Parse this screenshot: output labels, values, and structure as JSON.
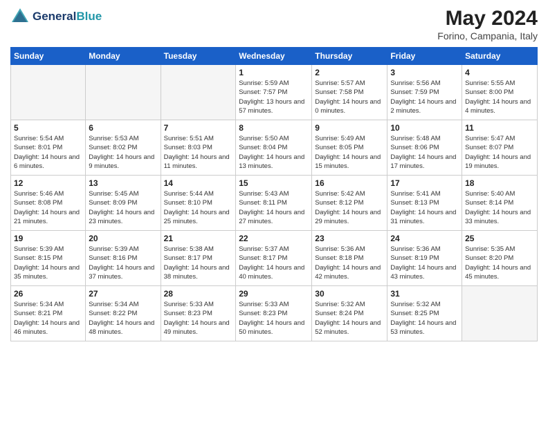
{
  "header": {
    "logo_line1": "General",
    "logo_line2": "Blue",
    "month": "May 2024",
    "location": "Forino, Campania, Italy"
  },
  "weekdays": [
    "Sunday",
    "Monday",
    "Tuesday",
    "Wednesday",
    "Thursday",
    "Friday",
    "Saturday"
  ],
  "weeks": [
    [
      {
        "day": "",
        "info": ""
      },
      {
        "day": "",
        "info": ""
      },
      {
        "day": "",
        "info": ""
      },
      {
        "day": "1",
        "info": "Sunrise: 5:59 AM\nSunset: 7:57 PM\nDaylight: 13 hours\nand 57 minutes."
      },
      {
        "day": "2",
        "info": "Sunrise: 5:57 AM\nSunset: 7:58 PM\nDaylight: 14 hours\nand 0 minutes."
      },
      {
        "day": "3",
        "info": "Sunrise: 5:56 AM\nSunset: 7:59 PM\nDaylight: 14 hours\nand 2 minutes."
      },
      {
        "day": "4",
        "info": "Sunrise: 5:55 AM\nSunset: 8:00 PM\nDaylight: 14 hours\nand 4 minutes."
      }
    ],
    [
      {
        "day": "5",
        "info": "Sunrise: 5:54 AM\nSunset: 8:01 PM\nDaylight: 14 hours\nand 6 minutes."
      },
      {
        "day": "6",
        "info": "Sunrise: 5:53 AM\nSunset: 8:02 PM\nDaylight: 14 hours\nand 9 minutes."
      },
      {
        "day": "7",
        "info": "Sunrise: 5:51 AM\nSunset: 8:03 PM\nDaylight: 14 hours\nand 11 minutes."
      },
      {
        "day": "8",
        "info": "Sunrise: 5:50 AM\nSunset: 8:04 PM\nDaylight: 14 hours\nand 13 minutes."
      },
      {
        "day": "9",
        "info": "Sunrise: 5:49 AM\nSunset: 8:05 PM\nDaylight: 14 hours\nand 15 minutes."
      },
      {
        "day": "10",
        "info": "Sunrise: 5:48 AM\nSunset: 8:06 PM\nDaylight: 14 hours\nand 17 minutes."
      },
      {
        "day": "11",
        "info": "Sunrise: 5:47 AM\nSunset: 8:07 PM\nDaylight: 14 hours\nand 19 minutes."
      }
    ],
    [
      {
        "day": "12",
        "info": "Sunrise: 5:46 AM\nSunset: 8:08 PM\nDaylight: 14 hours\nand 21 minutes."
      },
      {
        "day": "13",
        "info": "Sunrise: 5:45 AM\nSunset: 8:09 PM\nDaylight: 14 hours\nand 23 minutes."
      },
      {
        "day": "14",
        "info": "Sunrise: 5:44 AM\nSunset: 8:10 PM\nDaylight: 14 hours\nand 25 minutes."
      },
      {
        "day": "15",
        "info": "Sunrise: 5:43 AM\nSunset: 8:11 PM\nDaylight: 14 hours\nand 27 minutes."
      },
      {
        "day": "16",
        "info": "Sunrise: 5:42 AM\nSunset: 8:12 PM\nDaylight: 14 hours\nand 29 minutes."
      },
      {
        "day": "17",
        "info": "Sunrise: 5:41 AM\nSunset: 8:13 PM\nDaylight: 14 hours\nand 31 minutes."
      },
      {
        "day": "18",
        "info": "Sunrise: 5:40 AM\nSunset: 8:14 PM\nDaylight: 14 hours\nand 33 minutes."
      }
    ],
    [
      {
        "day": "19",
        "info": "Sunrise: 5:39 AM\nSunset: 8:15 PM\nDaylight: 14 hours\nand 35 minutes."
      },
      {
        "day": "20",
        "info": "Sunrise: 5:39 AM\nSunset: 8:16 PM\nDaylight: 14 hours\nand 37 minutes."
      },
      {
        "day": "21",
        "info": "Sunrise: 5:38 AM\nSunset: 8:17 PM\nDaylight: 14 hours\nand 38 minutes."
      },
      {
        "day": "22",
        "info": "Sunrise: 5:37 AM\nSunset: 8:17 PM\nDaylight: 14 hours\nand 40 minutes."
      },
      {
        "day": "23",
        "info": "Sunrise: 5:36 AM\nSunset: 8:18 PM\nDaylight: 14 hours\nand 42 minutes."
      },
      {
        "day": "24",
        "info": "Sunrise: 5:36 AM\nSunset: 8:19 PM\nDaylight: 14 hours\nand 43 minutes."
      },
      {
        "day": "25",
        "info": "Sunrise: 5:35 AM\nSunset: 8:20 PM\nDaylight: 14 hours\nand 45 minutes."
      }
    ],
    [
      {
        "day": "26",
        "info": "Sunrise: 5:34 AM\nSunset: 8:21 PM\nDaylight: 14 hours\nand 46 minutes."
      },
      {
        "day": "27",
        "info": "Sunrise: 5:34 AM\nSunset: 8:22 PM\nDaylight: 14 hours\nand 48 minutes."
      },
      {
        "day": "28",
        "info": "Sunrise: 5:33 AM\nSunset: 8:23 PM\nDaylight: 14 hours\nand 49 minutes."
      },
      {
        "day": "29",
        "info": "Sunrise: 5:33 AM\nSunset: 8:23 PM\nDaylight: 14 hours\nand 50 minutes."
      },
      {
        "day": "30",
        "info": "Sunrise: 5:32 AM\nSunset: 8:24 PM\nDaylight: 14 hours\nand 52 minutes."
      },
      {
        "day": "31",
        "info": "Sunrise: 5:32 AM\nSunset: 8:25 PM\nDaylight: 14 hours\nand 53 minutes."
      },
      {
        "day": "",
        "info": ""
      }
    ]
  ]
}
